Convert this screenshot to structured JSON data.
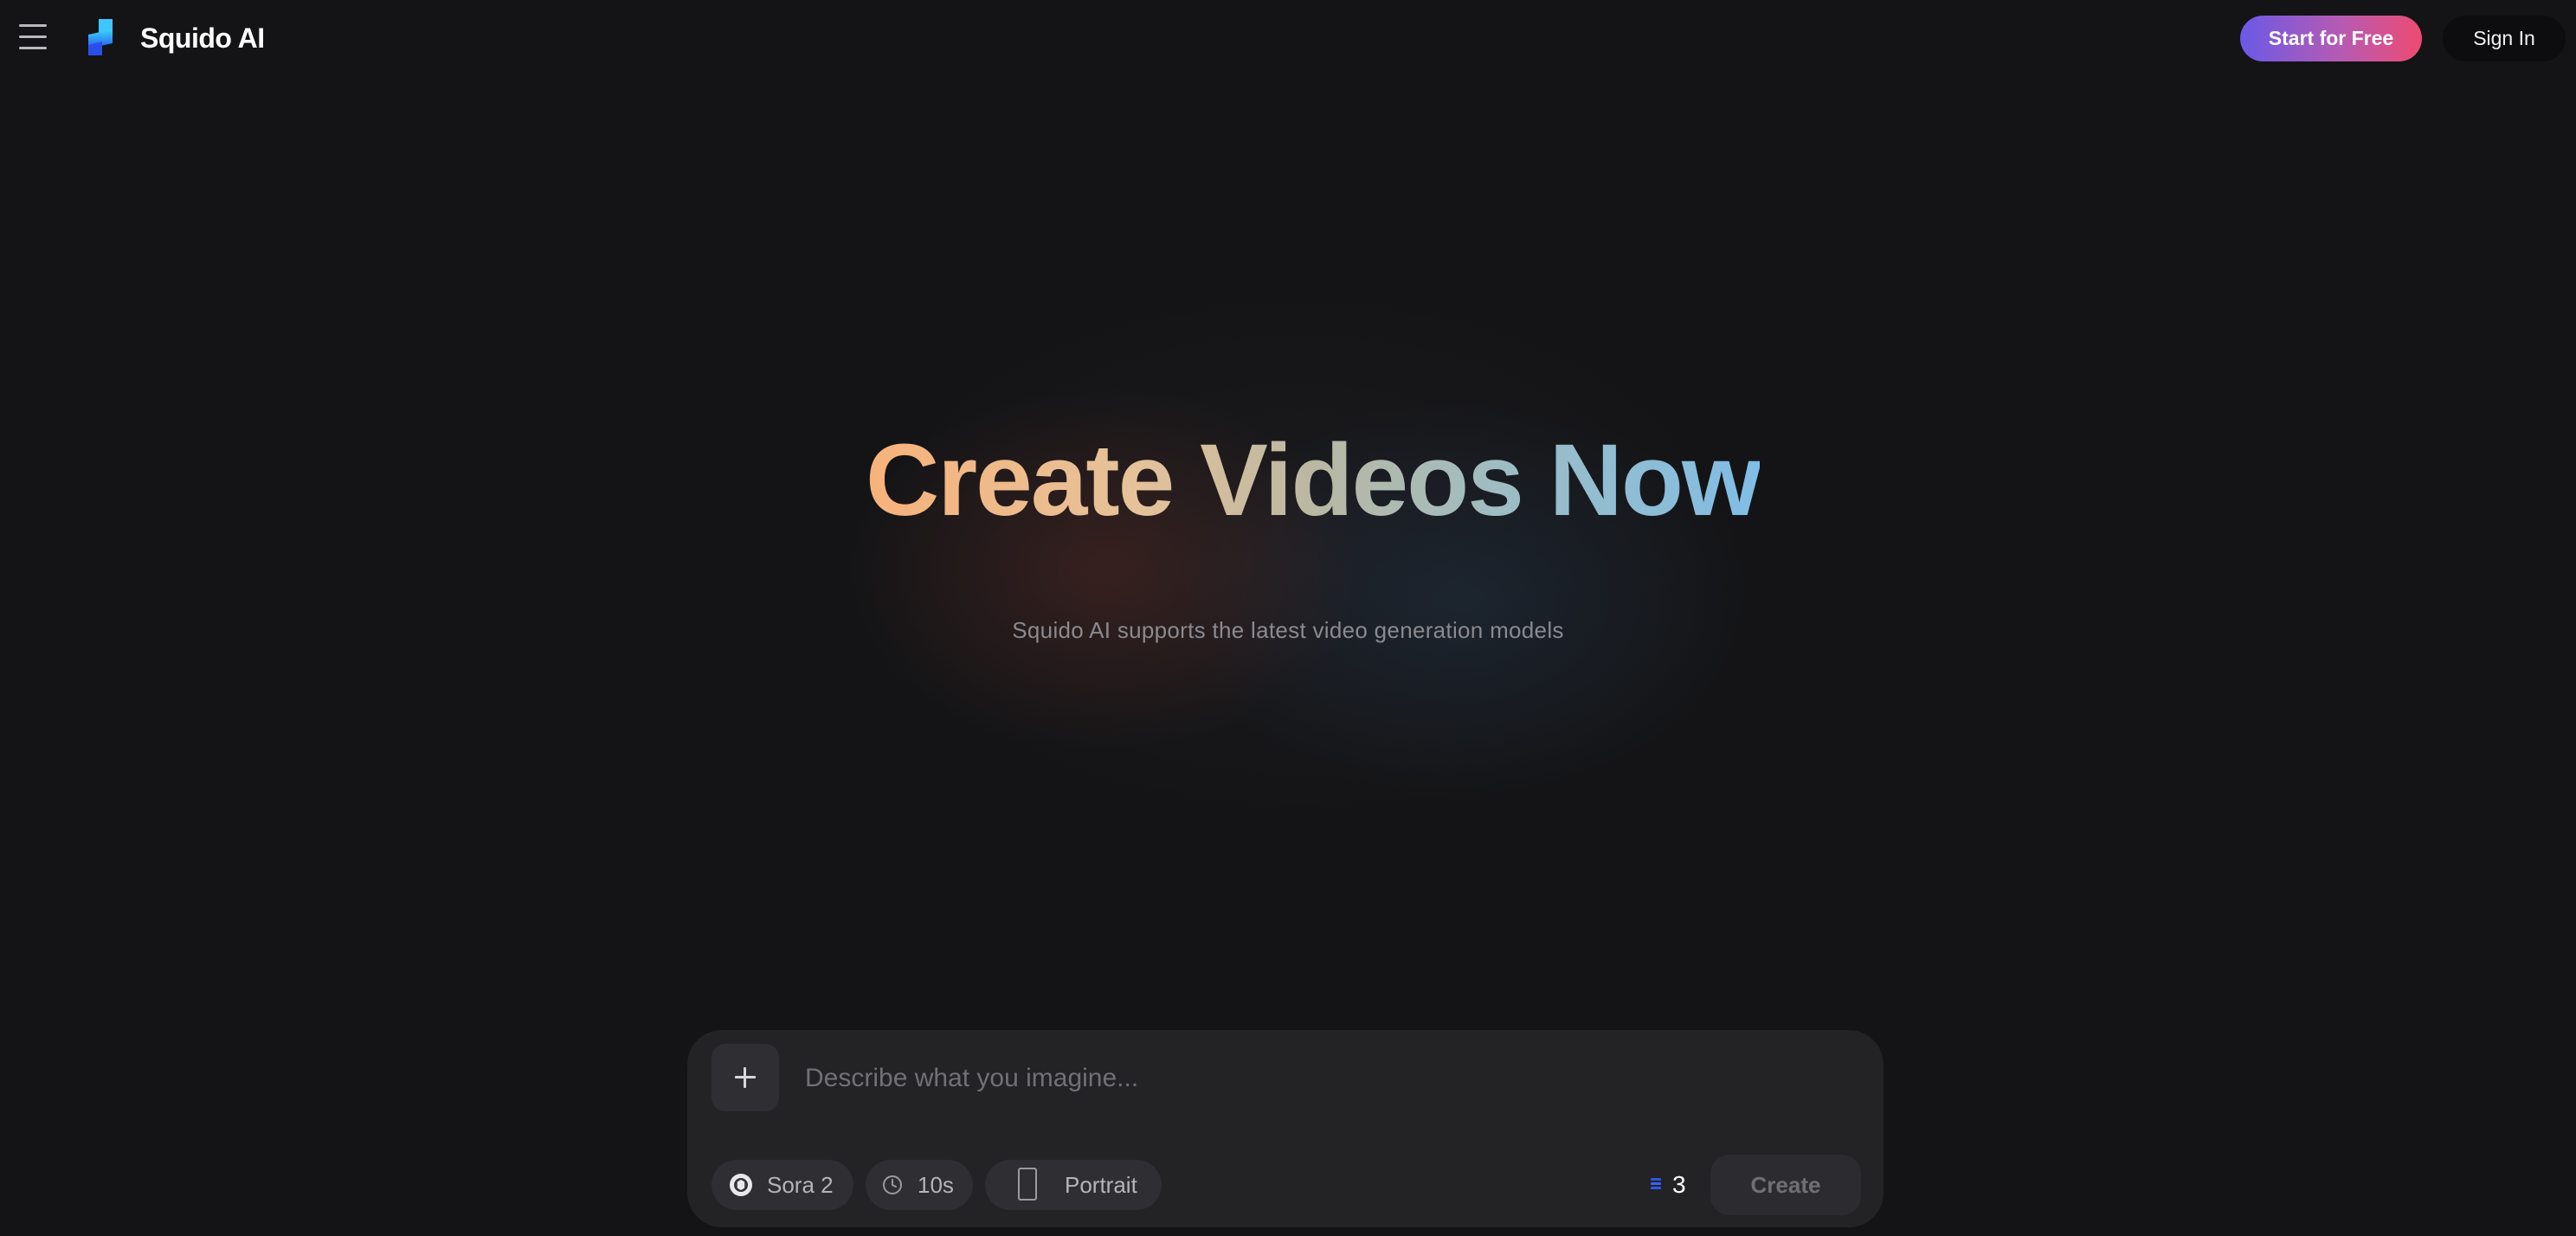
{
  "header": {
    "brand": "Squido AI",
    "start_label": "Start for Free",
    "signin_label": "Sign In"
  },
  "hero": {
    "title": "Create Videos Now",
    "subtitle": "Squido AI supports the latest video generation models"
  },
  "prompt": {
    "placeholder": "Describe what you imagine...",
    "model_label": "Sora 2",
    "duration_label": "10s",
    "aspect_label": "Portrait",
    "credits": "3",
    "create_label": "Create"
  },
  "colors": {
    "background": "#141416",
    "panel": "#232326",
    "start_gradient_start": "#6a5ae6",
    "start_gradient_end": "#ee4b72",
    "title_gradient_start": "#f7b27a",
    "title_gradient_end": "#80bde6",
    "credits_accent": "#2f55e6"
  },
  "icons": {
    "menu": "hamburger-menu-icon",
    "logo": "squido-logo",
    "plus": "plus-icon",
    "model": "openai-icon",
    "duration": "clock-icon",
    "aspect": "portrait-frame-icon",
    "credits": "credit-stack-icon"
  }
}
